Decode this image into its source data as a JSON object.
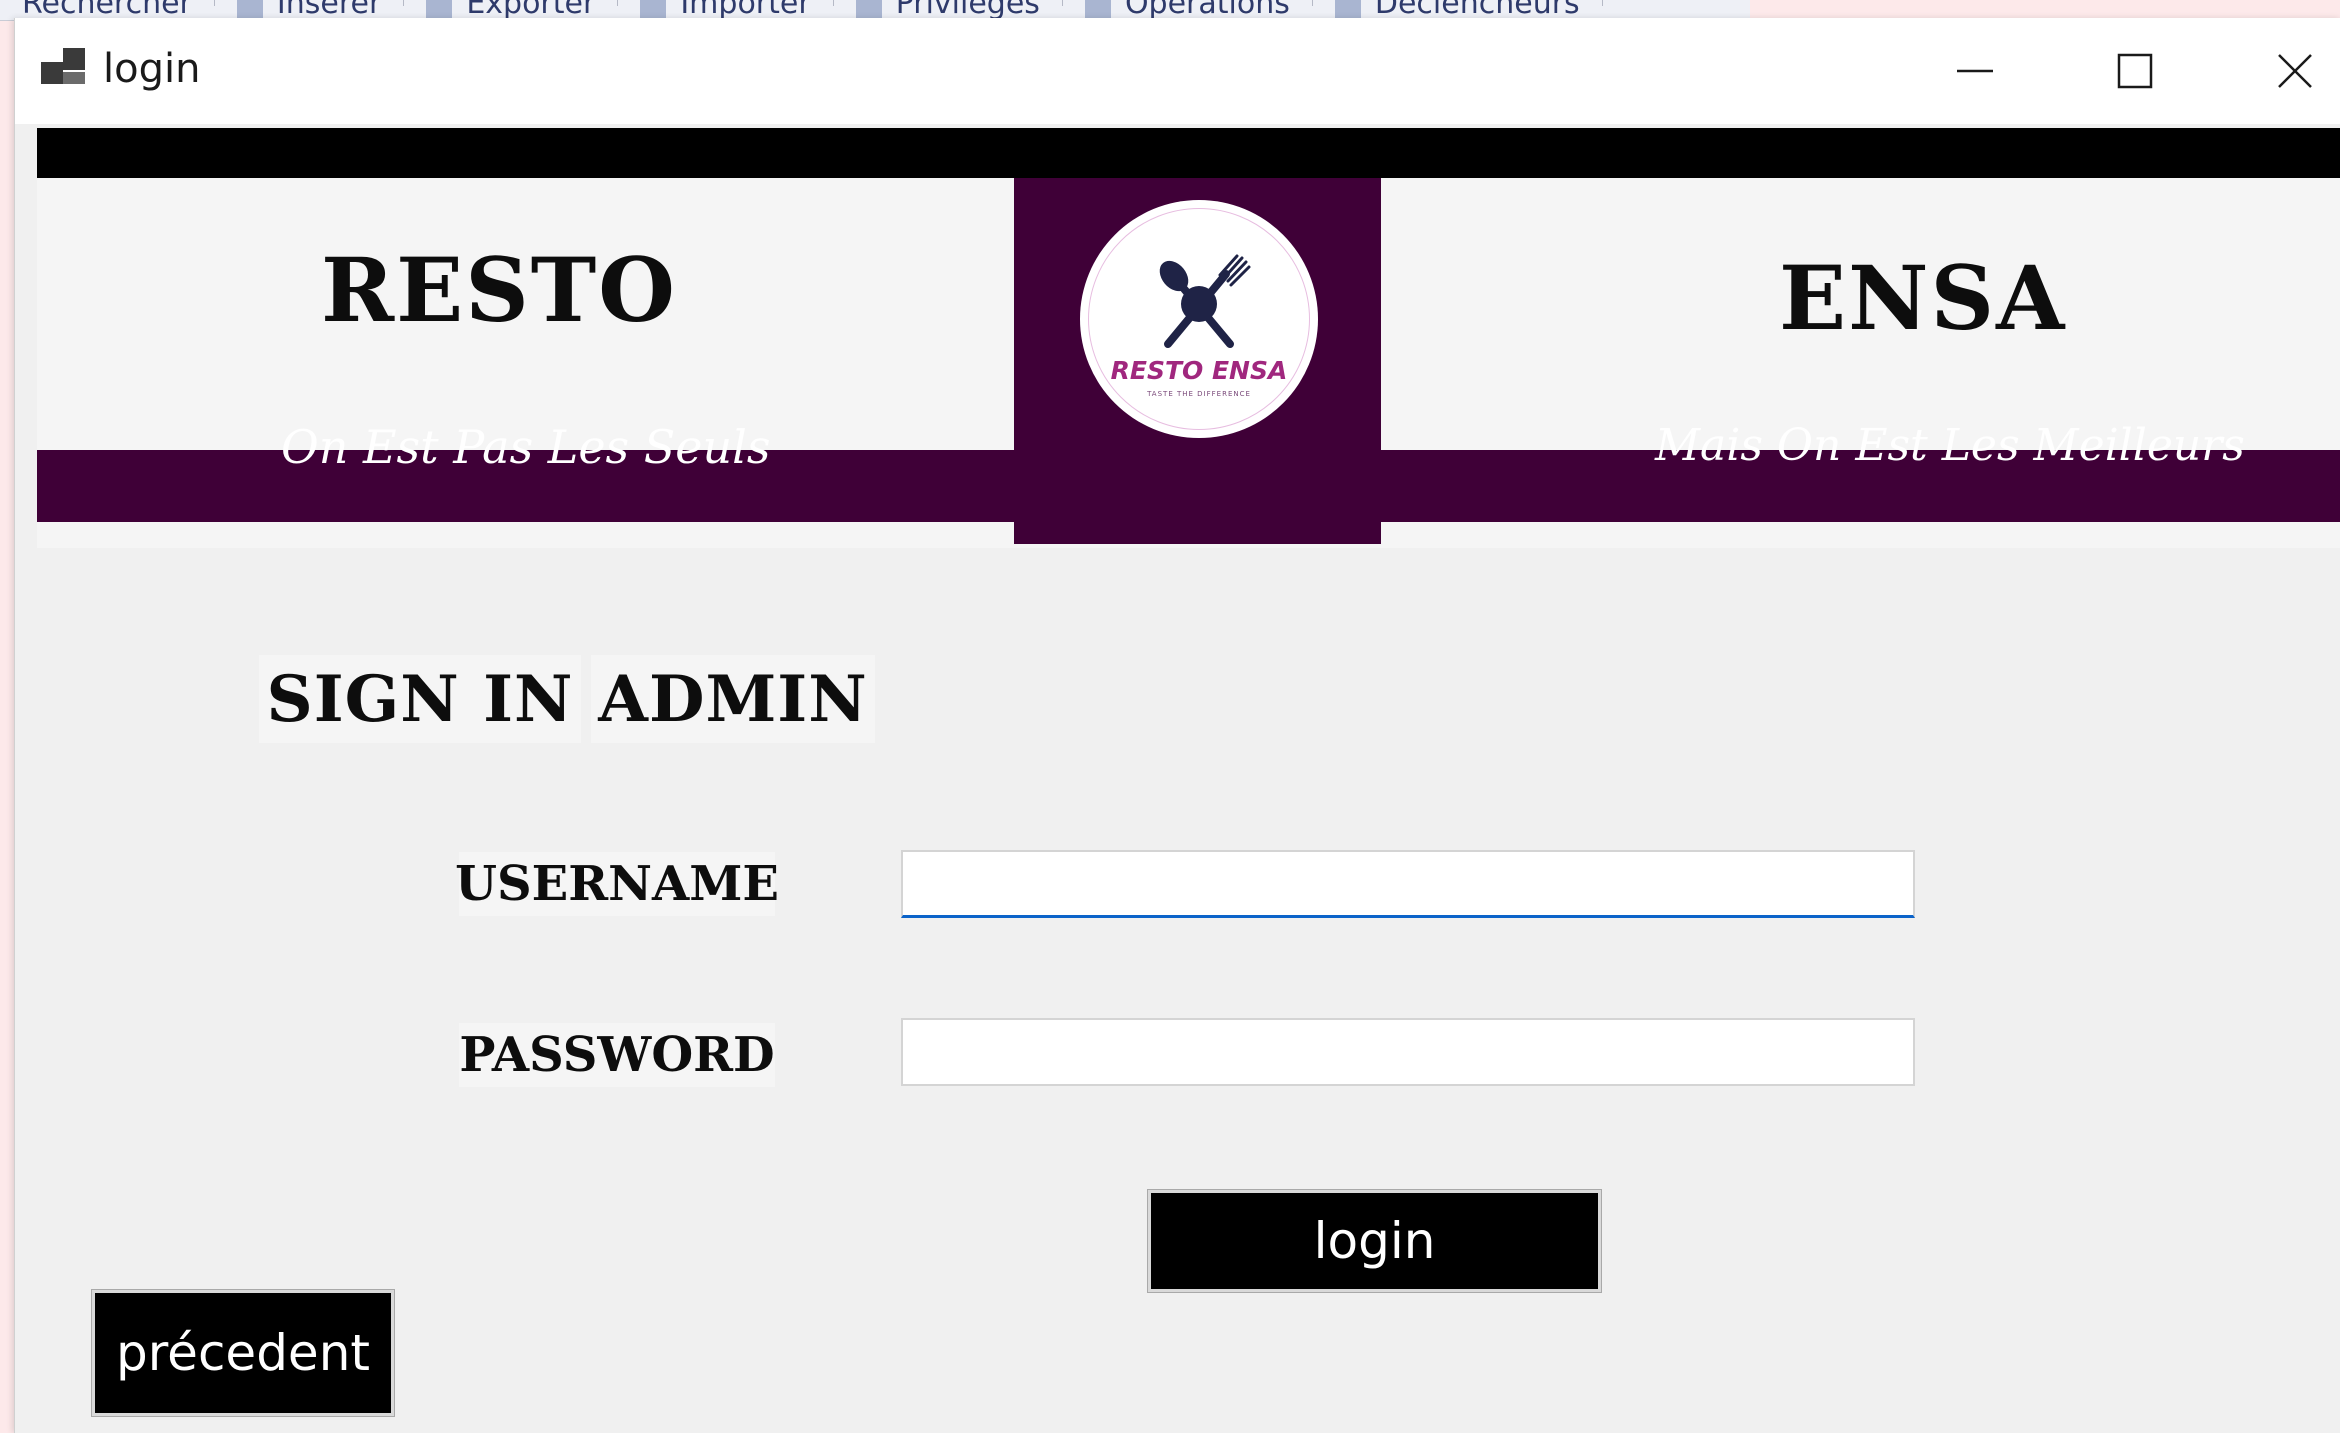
{
  "background_menu": {
    "items": [
      {
        "label": "Rechercher",
        "icon": "search-icon"
      },
      {
        "label": "Insérer",
        "icon": "insert-icon"
      },
      {
        "label": "Exporter",
        "icon": "export-icon"
      },
      {
        "label": "Importer",
        "icon": "import-icon"
      },
      {
        "label": "Privilèges",
        "icon": "privileges-icon"
      },
      {
        "label": "Opérations",
        "icon": "operations-icon"
      },
      {
        "label": "Déclencheurs",
        "icon": "triggers-icon"
      }
    ]
  },
  "window": {
    "title": "login",
    "icon": "app-window-icon",
    "controls": {
      "minimize": "minimize-icon",
      "maximize": "maximize-icon",
      "close": "close-icon"
    }
  },
  "banner": {
    "left_word": "RESTO",
    "right_word": "ENSA",
    "left_slogan": "On Est Pas Les Seuls",
    "right_slogan": "Mais On Est Les Meilleurs",
    "logo_text": "RESTO ENSA",
    "logo_tagline": "TASTE THE DIFFERENCE",
    "logo_icon": "spoon-fork-icon",
    "colors": {
      "purple": "#3f0037",
      "logo_text": "#a0277e",
      "black_bar": "#000000"
    }
  },
  "form": {
    "title_part1": "SIGN IN",
    "title_part2": "ADMIN",
    "username_label": "USERNAME",
    "password_label": "PASSWORD",
    "username_value": "",
    "password_value": "",
    "login_button": "login",
    "previous_button": "précedent",
    "focus_color": "#0b63c9"
  }
}
